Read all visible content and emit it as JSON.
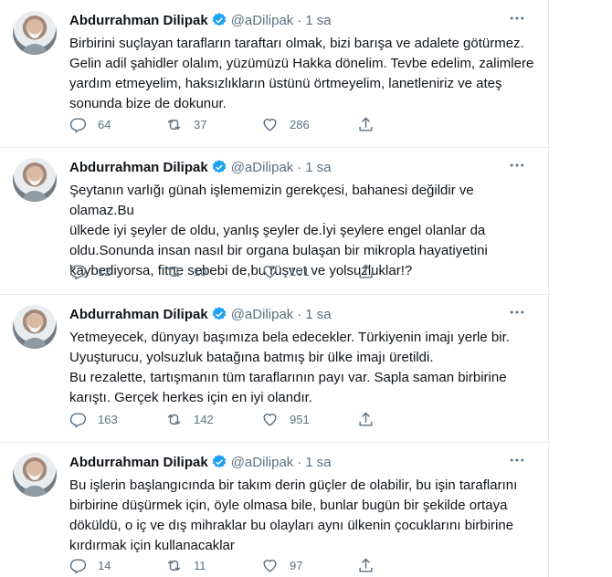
{
  "tweets": [
    {
      "name": "Abdurrahman Dilipak",
      "handle": "@aDilipak",
      "separator": "·",
      "time": "1 sa",
      "text": "Birbirini suçlayan tarafların taraftarı olmak, bizi barışa ve adalete götürmez.\nGelin adil şahidler olalım, yüzümüzü Hakka dönelim. Tevbe edelim, zalimlere\nyardım etmeyelim, haksızlıkların üstünü örtmeyelim, lanetleniriz ve ateş\nsonunda bize de dokunur.",
      "replies": "64",
      "retweets": "37",
      "likes": "286"
    },
    {
      "name": "Abdurrahman Dilipak",
      "handle": "@aDilipak",
      "separator": "·",
      "time": "1 sa",
      "text": "Şeytanın varlığı günah işlememizin gerekçesi, bahanesi değildir ve olamaz.Bu\nülkede iyi şeyler de oldu, yanlış şeyler de.İyi şeylere engel olanlar da\noldu.Sonunda insan nasıl bir organa bulaşan bir mikropla hayatiyetini\nkaybediyorsa, fitne sebebi de,bu rüşvet ve yolsuzluklar!?",
      "replies": "12",
      "retweets": "10",
      "likes": "101"
    },
    {
      "name": "Abdurrahman Dilipak",
      "handle": "@aDilipak",
      "separator": "·",
      "time": "1 sa",
      "text": "Yetmeyecek, dünyayı başımıza bela edecekler. Türkiyenin imajı yerle bir.\nUyuşturucu, yolsuzluk batağına batmış bir ülke imajı üretildi.\nBu rezalette, tartışmanın tüm taraflarının payı var. Sapla saman birbirine\nkarıştı. Gerçek herkes için en iyi olandır.",
      "replies": "163",
      "retweets": "142",
      "likes": "951"
    },
    {
      "name": "Abdurrahman Dilipak",
      "handle": "@aDilipak",
      "separator": "·",
      "time": "1 sa",
      "text": "Bu işlerin başlangıcında bir takım derin güçler de olabilir, bu işin taraflarını\nbirbirine düşürmek için, öyle olmasa bile, bunlar bugün bir şekilde ortaya\ndöküldü, o iç ve dış mihraklar bu olayları aynı ülkenin çocuklarını birbirine\nkırdırmak için kullanacaklar",
      "replies": "14",
      "retweets": "11",
      "likes": "97"
    }
  ],
  "icons": {
    "verified": "verified-badge-icon",
    "reply": "reply-icon",
    "retweet": "retweet-icon",
    "like": "like-icon",
    "share": "share-icon",
    "more": "more-icon"
  },
  "colors": {
    "verified": "#1da1f2",
    "icon": "#5b7083",
    "text": "#0f1419",
    "border": "#e6ecf0"
  }
}
